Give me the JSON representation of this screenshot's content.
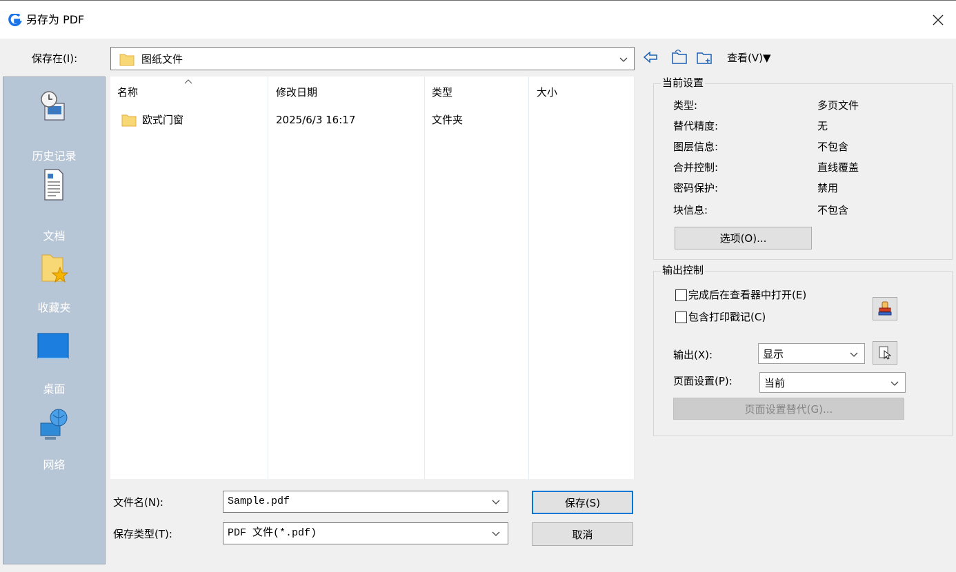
{
  "window": {
    "title": "另存为 PDF"
  },
  "save_in": {
    "label": "保存在(I):",
    "folder": "图纸文件",
    "view_menu": "查看(V)▼"
  },
  "places": [
    {
      "label": "历史记录",
      "icon": "history-icon"
    },
    {
      "label": "文档",
      "icon": "documents-icon"
    },
    {
      "label": "收藏夹",
      "icon": "favorites-icon"
    },
    {
      "label": "桌面",
      "icon": "desktop-icon"
    },
    {
      "label": "网络",
      "icon": "network-icon"
    }
  ],
  "file_list": {
    "columns": [
      "名称",
      "修改日期",
      "类型",
      "大小"
    ],
    "rows": [
      {
        "name": "欧式门窗",
        "modified": "2025/6/3 16:17",
        "type": "文件夹",
        "size": ""
      }
    ]
  },
  "filename": {
    "label": "文件名(N):",
    "value": "Sample.pdf"
  },
  "filetype": {
    "label": "保存类型(T):",
    "value": "PDF 文件(*.pdf)"
  },
  "buttons": {
    "save": "保存(S)",
    "cancel": "取消"
  },
  "current_settings": {
    "title": "当前设置",
    "items": [
      {
        "key": "类型:",
        "value": "多页文件"
      },
      {
        "key": "替代精度:",
        "value": "无"
      },
      {
        "key": "图层信息:",
        "value": "不包含"
      },
      {
        "key": "合并控制:",
        "value": "直线覆盖"
      },
      {
        "key": "密码保护:",
        "value": "禁用"
      },
      {
        "key": "块信息:",
        "value": "不包含"
      }
    ],
    "options_button": "选项(O)..."
  },
  "output_control": {
    "title": "输出控制",
    "open_in_viewer": "完成后在查看器中打开(E)",
    "include_stamp": "包含打印戳记(C)",
    "output_label": "输出(X):",
    "output_value": "显示",
    "page_setup_label": "页面设置(P):",
    "page_setup_value": "当前",
    "page_setup_override": "页面设置替代(G)..."
  },
  "colors": {
    "places_bg": "#b7c6d6",
    "accent": "#0078d7",
    "folder": "#f8d775"
  }
}
